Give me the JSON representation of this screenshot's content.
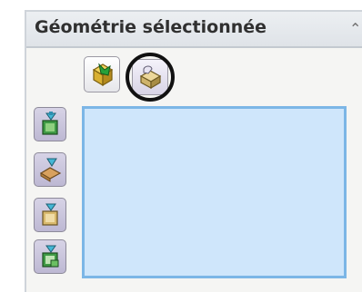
{
  "panel": {
    "title": "Géométrie sélectionnée",
    "collapse_icon": "double-chevron-up-icon"
  },
  "toolbar": {
    "items": [
      {
        "icon": "solid-body-selection-icon"
      },
      {
        "icon": "surface-body-selection-icon",
        "highlighted": true
      }
    ]
  },
  "side_buttons": [
    {
      "icon": "target-body-icon"
    },
    {
      "icon": "tool-body-icon"
    },
    {
      "icon": "keep-body-icon"
    },
    {
      "icon": "remove-body-icon"
    }
  ],
  "selection_box": {
    "items": []
  },
  "colors": {
    "selection_fill": "#cfe6fb",
    "selection_border": "#7cb6e6",
    "button_face": "#c8c3dc"
  }
}
